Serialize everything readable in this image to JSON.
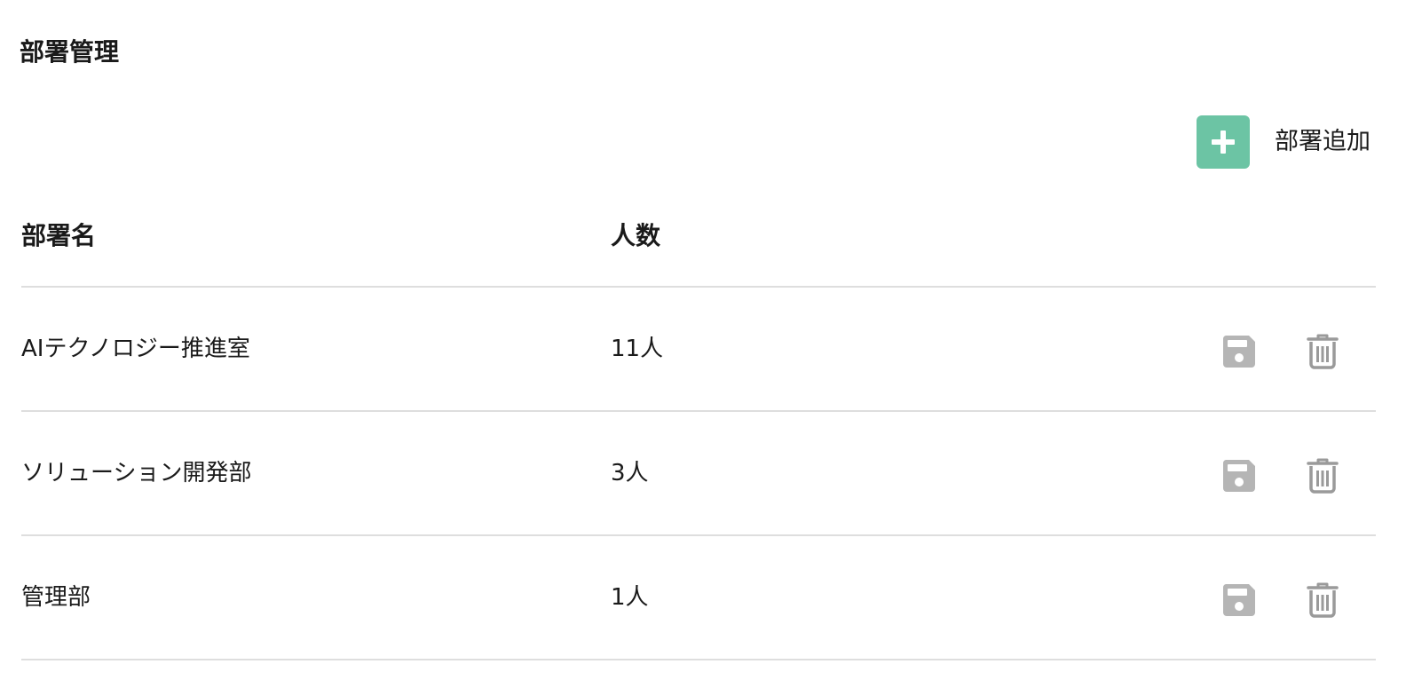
{
  "page": {
    "title": "部署管理"
  },
  "toolbar": {
    "add_label": "部署追加",
    "add_icon": "plus-icon"
  },
  "table": {
    "columns": [
      "部署名",
      "人数"
    ],
    "rows": [
      {
        "name": "AIテクノロジー推進室",
        "count": "11人"
      },
      {
        "name": "ソリューション開発部",
        "count": "3人"
      },
      {
        "name": "管理部",
        "count": "1人"
      }
    ],
    "row_actions": {
      "save_icon": "save-icon",
      "delete_icon": "trash-icon"
    }
  },
  "colors": {
    "accent": "#6cc4a4",
    "icon_gray": "#b5b5b5",
    "divider": "#dedede",
    "text": "#1a1a1a"
  }
}
